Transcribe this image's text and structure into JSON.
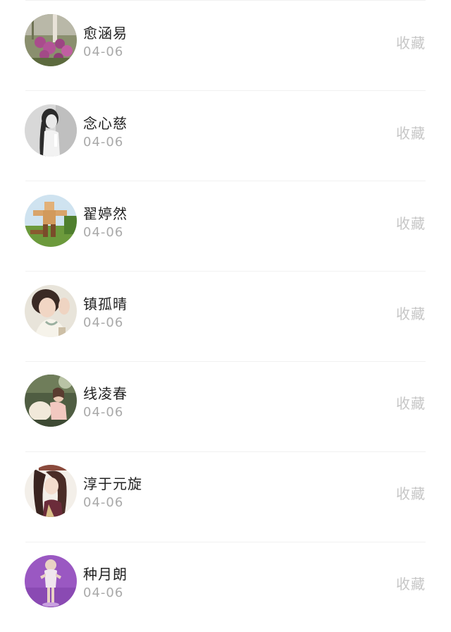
{
  "colors": {
    "name": "#222222",
    "date": "#a9a9a9",
    "favorite": "#c6c6c6",
    "divider": "#f1f1f1"
  },
  "items": [
    {
      "name": "愈涵易",
      "date": "04-06",
      "action": "收藏",
      "avatar_icon": "avatar-flowers-icon"
    },
    {
      "name": "念心慈",
      "date": "04-06",
      "action": "收藏",
      "avatar_icon": "avatar-woman-bw-icon"
    },
    {
      "name": "翟婷然",
      "date": "04-06",
      "action": "收藏",
      "avatar_icon": "avatar-blocky-figure-icon"
    },
    {
      "name": "镇孤晴",
      "date": "04-06",
      "action": "收藏",
      "avatar_icon": "avatar-woman-portrait-icon"
    },
    {
      "name": "线凌春",
      "date": "04-06",
      "action": "收藏",
      "avatar_icon": "avatar-girl-outdoor-icon"
    },
    {
      "name": "淳于元旋",
      "date": "04-06",
      "action": "收藏",
      "avatar_icon": "avatar-anime-character-icon"
    },
    {
      "name": "种月朗",
      "date": "04-06",
      "action": "收藏",
      "avatar_icon": "avatar-figure-purple-icon"
    }
  ]
}
